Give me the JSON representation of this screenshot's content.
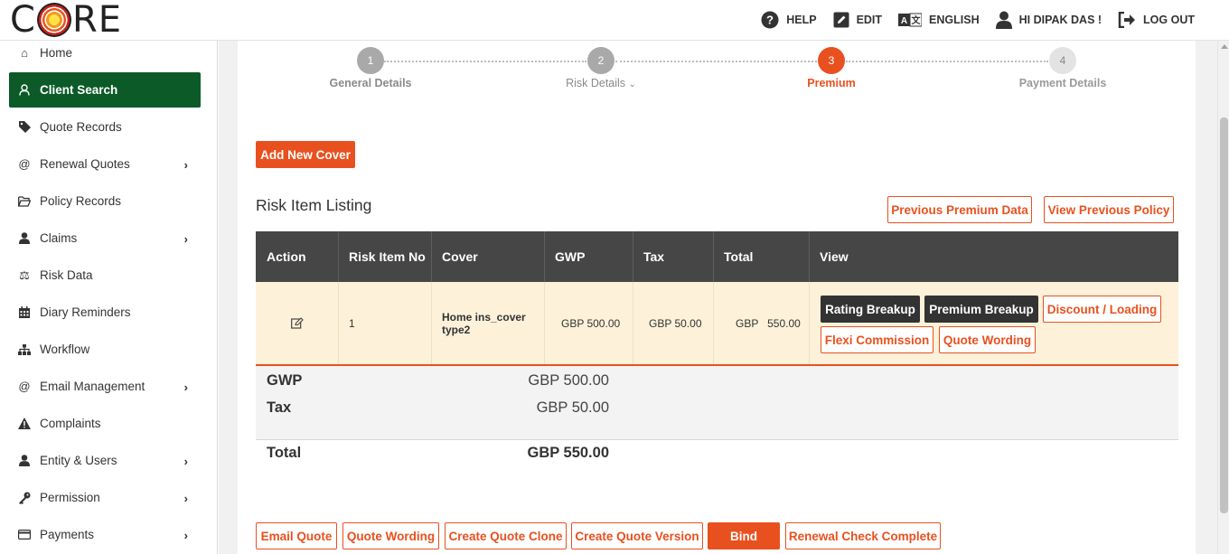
{
  "header": {
    "logo_text": "CORE",
    "nav": [
      {
        "label": "HELP",
        "icon": "help-icon"
      },
      {
        "label": "EDIT",
        "icon": "edit-icon"
      },
      {
        "label": "ENGLISH",
        "icon": "language-icon"
      },
      {
        "label": "HI DIPAK DAS !",
        "icon": "user-icon"
      },
      {
        "label": "LOG OUT",
        "icon": "logout-icon"
      }
    ]
  },
  "sidebar": {
    "items": [
      {
        "label": "Home",
        "icon": "home-icon"
      },
      {
        "label": "Client Search",
        "icon": "user-outline-icon",
        "active": true
      },
      {
        "label": "Quote Records",
        "icon": "tag-icon"
      },
      {
        "label": "Renewal Quotes",
        "icon": "at-icon",
        "has_children": true
      },
      {
        "label": "Policy Records",
        "icon": "folder-open-icon"
      },
      {
        "label": "Claims",
        "icon": "user-icon",
        "has_children": true
      },
      {
        "label": "Risk Data",
        "icon": "balance-scale-icon"
      },
      {
        "label": "Diary Reminders",
        "icon": "calendar-icon"
      },
      {
        "label": "Workflow",
        "icon": "sitemap-icon"
      },
      {
        "label": "Email Management",
        "icon": "at-icon",
        "has_children": true
      },
      {
        "label": "Complaints",
        "icon": "warning-icon"
      },
      {
        "label": "Entity & Users",
        "icon": "user-icon",
        "has_children": true
      },
      {
        "label": "Permission",
        "icon": "key-icon",
        "has_children": true
      },
      {
        "label": "Payments",
        "icon": "credit-card-icon",
        "has_children": true
      }
    ]
  },
  "stepper": {
    "steps": [
      {
        "number": "1",
        "label": "General Details",
        "state": "done"
      },
      {
        "number": "2",
        "label": "Risk Details",
        "state": "done",
        "has_dropdown": true
      },
      {
        "number": "3",
        "label": "Premium",
        "state": "active"
      },
      {
        "number": "4",
        "label": "Payment Details",
        "state": "pending"
      }
    ]
  },
  "add_cover_label": "Add New Cover",
  "listing": {
    "title": "Risk Item Listing",
    "previous_premium_label": "Previous Premium Data",
    "view_previous_policy_label": "View Previous Policy",
    "columns": [
      "Action",
      "Risk Item No",
      "Cover",
      "GWP",
      "Tax",
      "Total",
      "View"
    ],
    "rows": [
      {
        "risk_item_no": "1",
        "cover": "Home ins_cover type2",
        "gwp": "GBP  500.00",
        "tax": "GBP  50.00",
        "total": "GBP   550.00",
        "view_buttons": {
          "rating_breakup": "Rating Breakup",
          "premium_breakup": "Premium Breakup",
          "discount_loading": "Discount / Loading",
          "flexi_commission": "Flexi Commission",
          "quote_wording": "Quote Wording"
        }
      }
    ]
  },
  "summary": {
    "gwp_label": "GWP",
    "gwp_value": "GBP 500.00",
    "tax_label": "Tax",
    "tax_value": "GBP 50.00",
    "total_label": "Total",
    "total_value": "GBP 550.00"
  },
  "footer_buttons": {
    "email_quote": "Email Quote",
    "quote_wording": "Quote Wording",
    "create_clone": "Create Quote Clone",
    "create_version": "Create Quote Version",
    "bind": "Bind",
    "renewal_check": "Renewal Check Complete"
  },
  "colors": {
    "accent": "#e8511f",
    "sidebar_active": "#0c5a28",
    "table_header": "#464646",
    "row_highlight": "#fdf1d9"
  }
}
